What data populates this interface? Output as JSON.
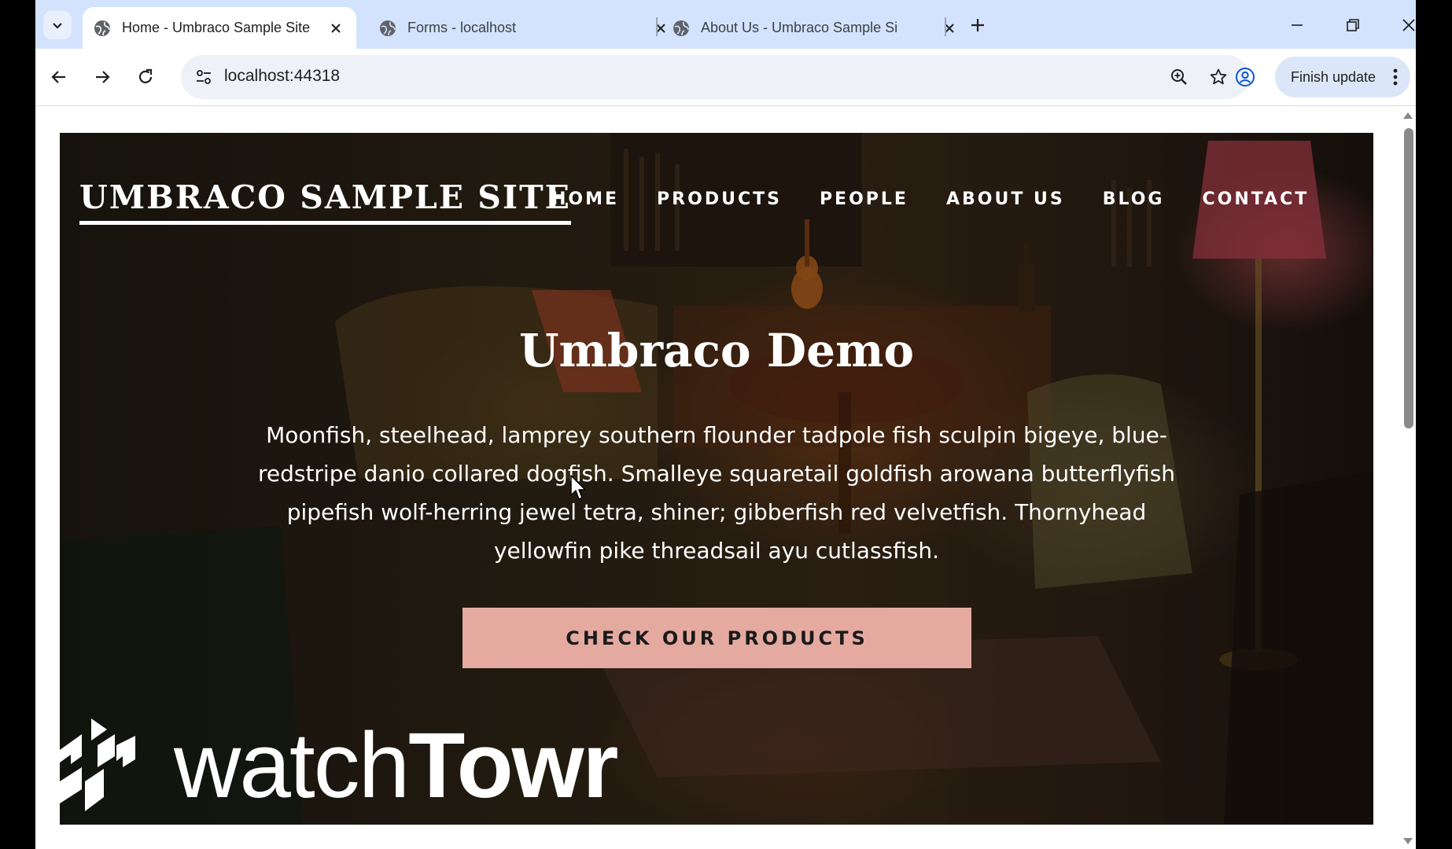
{
  "browser": {
    "tabs": [
      {
        "title": "Home - Umbraco Sample Site",
        "active": true
      },
      {
        "title": "Forms - localhost",
        "active": false
      },
      {
        "title": "About Us - Umbraco Sample Si",
        "active": false
      }
    ],
    "url": "localhost:44318",
    "update_button_label": "Finish update"
  },
  "site": {
    "logo": "UMBRACO SAMPLE SITE",
    "nav": [
      "HOME",
      "PRODUCTS",
      "PEOPLE",
      "ABOUT US",
      "BLOG",
      "CONTACT"
    ],
    "hero": {
      "title": "Umbraco Demo",
      "text": "Moonfish, steelhead, lamprey southern flounder tadpole fish sculpin bigeye, blue-redstripe danio collared dogfish. Smalleye squaretail goldfish arowana butterflyfish pipefish wolf-herring jewel tetra, shiner; gibberfish red velvetfish. Thornyhead yellowfin pike threadsail ayu cutlassfish.",
      "cta_label": "CHECK OUR PRODUCTS"
    }
  },
  "watermark": {
    "light": "watch",
    "bold": "Towr"
  },
  "colors": {
    "tabstrip": "#d3e3fd",
    "omnibox": "#eef1f8",
    "cta_background": "#e4aaa0",
    "hero_text": "#ffffff"
  }
}
